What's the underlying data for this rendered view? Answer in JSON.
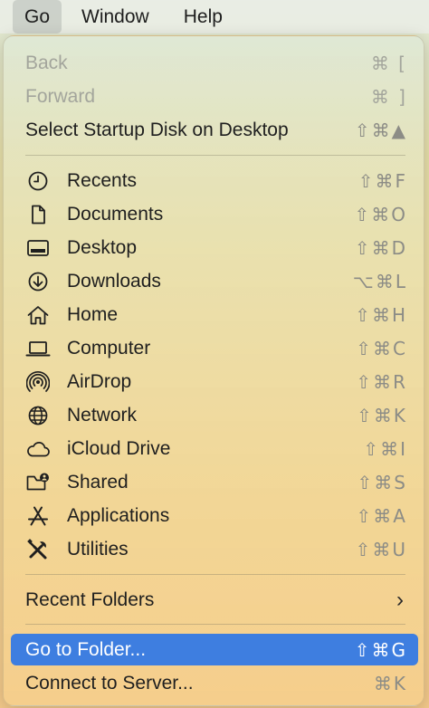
{
  "menubar": {
    "go": "Go",
    "window": "Window",
    "help": "Help"
  },
  "menu": {
    "back": {
      "label": "Back",
      "shortcut": "⌘ ["
    },
    "forward": {
      "label": "Forward",
      "shortcut": "⌘ ]"
    },
    "startup_disk": {
      "label": "Select Startup Disk on Desktop",
      "shortcut": "⇧⌘▲"
    },
    "recents": {
      "label": "Recents",
      "shortcut": "⇧⌘F",
      "icon": "clock-icon"
    },
    "documents": {
      "label": "Documents",
      "shortcut": "⇧⌘O",
      "icon": "document-icon"
    },
    "desktop": {
      "label": "Desktop",
      "shortcut": "⇧⌘D",
      "icon": "desktop-icon"
    },
    "downloads": {
      "label": "Downloads",
      "shortcut": "⌥⌘L",
      "icon": "download-icon"
    },
    "home": {
      "label": "Home",
      "shortcut": "⇧⌘H",
      "icon": "home-icon"
    },
    "computer": {
      "label": "Computer",
      "shortcut": "⇧⌘C",
      "icon": "laptop-icon"
    },
    "airdrop": {
      "label": "AirDrop",
      "shortcut": "⇧⌘R",
      "icon": "airdrop-icon"
    },
    "network": {
      "label": "Network",
      "shortcut": "⇧⌘K",
      "icon": "globe-icon"
    },
    "icloud": {
      "label": "iCloud Drive",
      "shortcut": "⇧⌘I",
      "icon": "cloud-icon"
    },
    "shared": {
      "label": "Shared",
      "shortcut": "⇧⌘S",
      "icon": "shared-folder-icon"
    },
    "applications": {
      "label": "Applications",
      "shortcut": "⇧⌘A",
      "icon": "applications-icon"
    },
    "utilities": {
      "label": "Utilities",
      "shortcut": "⇧⌘U",
      "icon": "tools-icon"
    },
    "recent_folders": {
      "label": "Recent Folders",
      "chevron": "›"
    },
    "go_to_folder": {
      "label": "Go to Folder...",
      "shortcut": "⇧⌘G"
    },
    "connect_server": {
      "label": "Connect to Server...",
      "shortcut": "⌘K"
    }
  },
  "colors": {
    "highlight": "#3e7ee0",
    "disabled_text": "#a3a59c",
    "shortcut_text": "#8c8c86"
  }
}
